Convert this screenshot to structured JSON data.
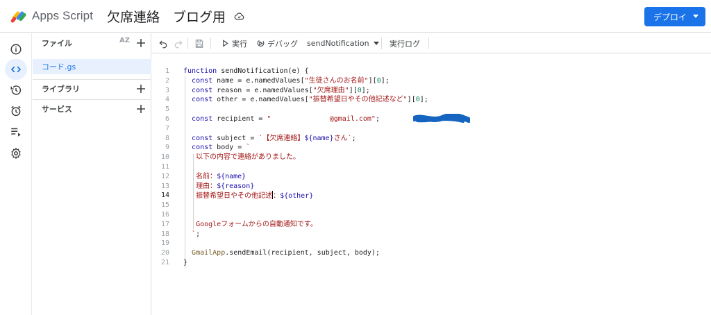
{
  "header": {
    "app_name": "Apps Script",
    "project_title": "欠席連絡　ブログ用",
    "deploy_label": "デプロイ"
  },
  "colors": {
    "accent": "#1a73e8",
    "active_bg": "#e8f0fe",
    "redaction": "#1565c0"
  },
  "rail": {
    "items": [
      {
        "icon": "info-icon"
      },
      {
        "icon": "code-icon",
        "active": true
      },
      {
        "icon": "history-icon"
      },
      {
        "icon": "alarm-icon"
      },
      {
        "icon": "executions-icon"
      },
      {
        "icon": "gear-icon"
      }
    ]
  },
  "panel": {
    "files_label": "ファイル",
    "sort_label": "AZ",
    "file_name": "コード.gs",
    "libraries_label": "ライブラリ",
    "services_label": "サービス"
  },
  "toolbar": {
    "run_label": "実行",
    "debug_label": "デバッグ",
    "function_name": "sendNotification",
    "log_label": "実行ログ"
  },
  "editor": {
    "current_line": 14,
    "lines": [
      {
        "n": "1",
        "tokens": [
          [
            "kw",
            "function "
          ],
          [
            "",
            "sendNotification(e) {"
          ]
        ]
      },
      {
        "n": "2",
        "tokens": [
          [
            "",
            "  "
          ],
          [
            "kw",
            "const "
          ],
          [
            "",
            "name = e.namedValues["
          ],
          [
            "str",
            "\"生徒さんのお名前\""
          ],
          [
            "",
            "]["
          ],
          [
            "num",
            "0"
          ],
          [
            "",
            "];"
          ]
        ]
      },
      {
        "n": "3",
        "tokens": [
          [
            "",
            "  "
          ],
          [
            "kw",
            "const "
          ],
          [
            "",
            "reason = e.namedValues["
          ],
          [
            "str",
            "\"欠席理由\""
          ],
          [
            "",
            "]["
          ],
          [
            "num",
            "0"
          ],
          [
            "",
            "];"
          ]
        ]
      },
      {
        "n": "4",
        "tokens": [
          [
            "",
            "  "
          ],
          [
            "kw",
            "const "
          ],
          [
            "",
            "other = e.namedValues["
          ],
          [
            "str",
            "\"振替希望日やその他記述など\""
          ],
          [
            "",
            "]["
          ],
          [
            "num",
            "0"
          ],
          [
            "",
            "];"
          ]
        ]
      },
      {
        "n": "5",
        "tokens": []
      },
      {
        "n": "6",
        "tokens": [
          [
            "",
            "  "
          ],
          [
            "kw",
            "const "
          ],
          [
            "",
            "recipient = "
          ],
          [
            "str",
            "\"              @gmail.com\""
          ],
          [
            "",
            ";"
          ]
        ]
      },
      {
        "n": "7",
        "tokens": []
      },
      {
        "n": "8",
        "tokens": [
          [
            "",
            "  "
          ],
          [
            "kw",
            "const "
          ],
          [
            "",
            "subject = "
          ],
          [
            "str",
            "`【欠席連絡】"
          ],
          [
            "tmpl",
            "${name}"
          ],
          [
            "str",
            "さん`"
          ],
          [
            "",
            ";"
          ]
        ]
      },
      {
        "n": "9",
        "tokens": [
          [
            "",
            "  "
          ],
          [
            "kw",
            "const "
          ],
          [
            "",
            "body = "
          ],
          [
            "str",
            "`"
          ]
        ]
      },
      {
        "n": "10",
        "tokens": [
          [
            "",
            "   "
          ],
          [
            "str",
            "以下の内容で連絡がありました。"
          ]
        ]
      },
      {
        "n": "11",
        "tokens": []
      },
      {
        "n": "12",
        "tokens": [
          [
            "",
            "   "
          ],
          [
            "str",
            "名前："
          ],
          [
            "tmpl",
            "${name}"
          ]
        ]
      },
      {
        "n": "13",
        "tokens": [
          [
            "",
            "   "
          ],
          [
            "str",
            "理由："
          ],
          [
            "tmpl",
            "${reason}"
          ]
        ]
      },
      {
        "n": "14",
        "tokens": [
          [
            "",
            "   "
          ],
          [
            "str",
            "振替希望日やその他記述"
          ],
          [
            "cursor",
            ""
          ],
          [
            "str",
            "："
          ],
          [
            "tmpl",
            "${other}"
          ]
        ]
      },
      {
        "n": "15",
        "tokens": []
      },
      {
        "n": "16",
        "tokens": []
      },
      {
        "n": "17",
        "tokens": [
          [
            "",
            "   "
          ],
          [
            "str",
            "Googleフォームからの自動通知です。"
          ]
        ]
      },
      {
        "n": "18",
        "tokens": [
          [
            "",
            "  "
          ],
          [
            "str",
            "`"
          ],
          [
            "",
            ";"
          ]
        ]
      },
      {
        "n": "19",
        "tokens": []
      },
      {
        "n": "20",
        "tokens": [
          [
            "",
            "  "
          ],
          [
            "fn",
            "GmailApp"
          ],
          [
            "",
            ".sendEmail(recipient, subject, body);"
          ]
        ]
      },
      {
        "n": "21",
        "tokens": [
          [
            "",
            "}"
          ]
        ]
      }
    ]
  }
}
